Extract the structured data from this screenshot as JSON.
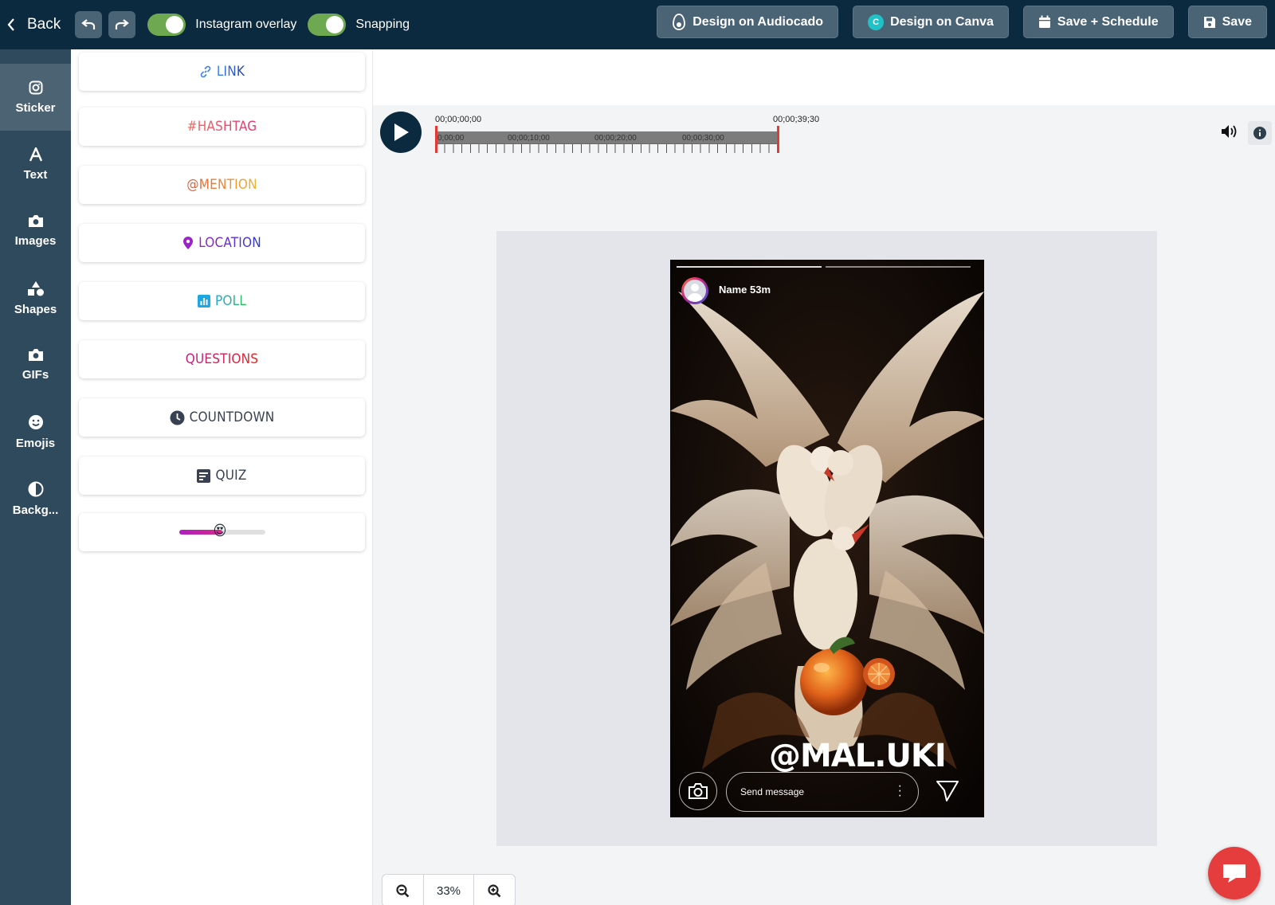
{
  "topbar": {
    "back_label": "Back",
    "toggles": [
      {
        "label": "Instagram overlay",
        "on": true
      },
      {
        "label": "Snapping",
        "on": true
      }
    ],
    "buttons": {
      "audiocado": "Design on Audiocado",
      "canva": "Design on Canva",
      "canva_logo": "C",
      "save_schedule": "Save + Schedule",
      "save": "Save"
    }
  },
  "rail": {
    "items": [
      {
        "label": "Sticker",
        "icon": "instagram-icon",
        "active": true
      },
      {
        "label": "Text",
        "icon": "text-a-icon"
      },
      {
        "label": "Images",
        "icon": "camera-icon"
      },
      {
        "label": "Shapes",
        "icon": "shapes-icon"
      },
      {
        "label": "GIFs",
        "icon": "camera-icon"
      },
      {
        "label": "Emojis",
        "icon": "smile-icon"
      },
      {
        "label": "Backg...",
        "icon": "contrast-icon"
      }
    ]
  },
  "stickers": {
    "link": {
      "label": "LINK",
      "color": "#3b82f6"
    },
    "hashtag": {
      "label": "#HASHTAG",
      "color": "#e84d5b"
    },
    "mention": {
      "label": "@MENTION",
      "color": "#e8903a"
    },
    "location": {
      "label": "LOCATION",
      "color": "#7a2ad6"
    },
    "poll": {
      "label": "POLL",
      "color": "#22b573"
    },
    "questions": {
      "label": "QUESTIONS",
      "color": "#d4124e"
    },
    "countdown": {
      "label": "COUNTDOWN",
      "color": "#374151"
    },
    "quiz": {
      "label": "QUIZ",
      "color": "#374151"
    },
    "slider": {
      "emoji": "😍",
      "level": 0.5
    }
  },
  "timeline": {
    "start": "00;00;00;00",
    "end": "00;00;39;30",
    "marks": [
      "0;00;00",
      "00;00;10;00",
      "00;00;20;00",
      "00;00;30;00"
    ]
  },
  "story": {
    "name": "Name 53m",
    "overlay_text": "@MAL.UKI",
    "message_placeholder": "Send message"
  },
  "zoom": {
    "value": "33%"
  }
}
